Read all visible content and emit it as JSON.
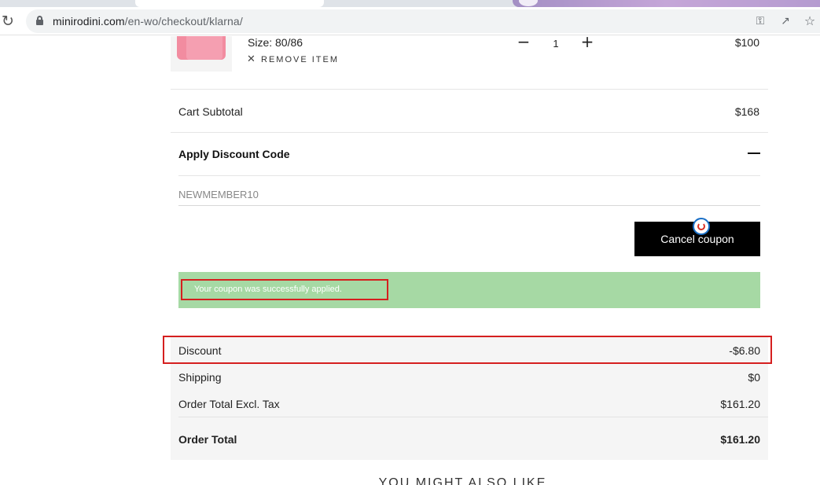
{
  "browser": {
    "url_domain": "minirodini.com",
    "url_path": "/en-wo/checkout/klarna/",
    "icons": [
      "reload-icon",
      "lock-icon",
      "key-icon",
      "share-icon",
      "star-icon"
    ]
  },
  "cart_item": {
    "size": "Size: 80/86",
    "remove_label": "REMOVE ITEM",
    "quantity": "1",
    "price": "$100"
  },
  "subtotal": {
    "label": "Cart Subtotal",
    "value": "$168"
  },
  "discount_code": {
    "heading": "Apply Discount Code",
    "input_value": "NEWMEMBER10",
    "cancel_button": "Cancel coupon",
    "success_message": "Your coupon was successfully applied."
  },
  "totals": {
    "discount_label": "Discount",
    "discount_value": "-$6.80",
    "shipping_label": "Shipping",
    "shipping_value": "$0",
    "excl_tax_label": "Order Total Excl. Tax",
    "excl_tax_value": "$161.20",
    "order_total_label": "Order Total",
    "order_total_value": "$161.20"
  },
  "recommendations_heading": "YOU MIGHT ALSO LIKE",
  "colors": {
    "success_bg": "#a6d9a4",
    "highlight_outline": "#d51f1f",
    "button_bg": "#000000"
  }
}
